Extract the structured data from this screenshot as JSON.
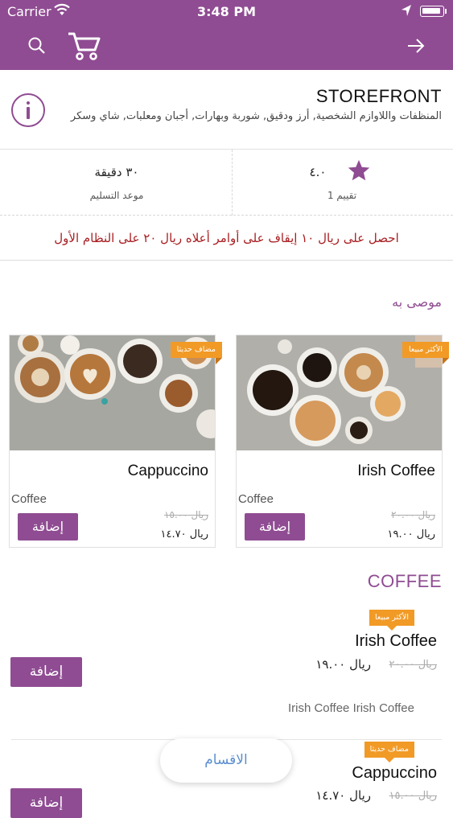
{
  "status_bar": {
    "carrier": "Carrier",
    "time": "3:48 PM"
  },
  "store": {
    "name": "STOREFRONT",
    "categories": "المنظفات واللاوازم الشخصية, أرز ودقيق, شوربة وبهارات, أجبان ومعلبات, شاي وسكر"
  },
  "stats": {
    "delivery_time": "٣٠ دقيقة",
    "delivery_label": "موعد التسليم",
    "rating": "٤.٠",
    "rating_count": "1 تقييم"
  },
  "promo": {
    "text": "احصل على ريال ١٠ إيقاف على أوامر أعلاه ريال ٢٠  على النظام الأول"
  },
  "recommended": {
    "title": "موصى به",
    "items": [
      {
        "name": "Irish Coffee",
        "category": "Coffee",
        "badge": "الأكثر مبيعا",
        "old_price": "ريال ٢٠.٠٠",
        "price": "ريال ١٩.٠٠",
        "add_label": "إضافة"
      },
      {
        "name": "Cappuccino",
        "category": "Coffee",
        "badge": "مضاف حديثا",
        "old_price": "ريال ١٥.٠٠",
        "price": "ريال ١٤.٧٠",
        "add_label": "إضافة"
      }
    ]
  },
  "coffee": {
    "title": "COFFEE",
    "items": [
      {
        "name": "Irish Coffee",
        "badge": "الأكثر مبيعا",
        "old_price": "ريال ٢٠.٠٠",
        "price": "ريال ١٩.٠٠",
        "description": "Irish Coffee Irish Coffee",
        "add_label": "إضافة"
      },
      {
        "name": "Cappuccino",
        "badge": "مضاف حديثا",
        "old_price": "ريال ١٥.٠٠",
        "price": "ريال ١٤.٧٠",
        "add_label": "إضافة"
      }
    ]
  },
  "categories_button": "الاقسام",
  "colors": {
    "brand": "#8f4c92",
    "badge": "#f19a26",
    "promo": "#a81f22",
    "link": "#5b8fcf"
  },
  "icons": [
    "wifi-icon",
    "location-arrow-icon",
    "battery-icon",
    "search-icon",
    "cart-icon",
    "arrow-right-icon",
    "info-icon",
    "star-icon"
  ]
}
